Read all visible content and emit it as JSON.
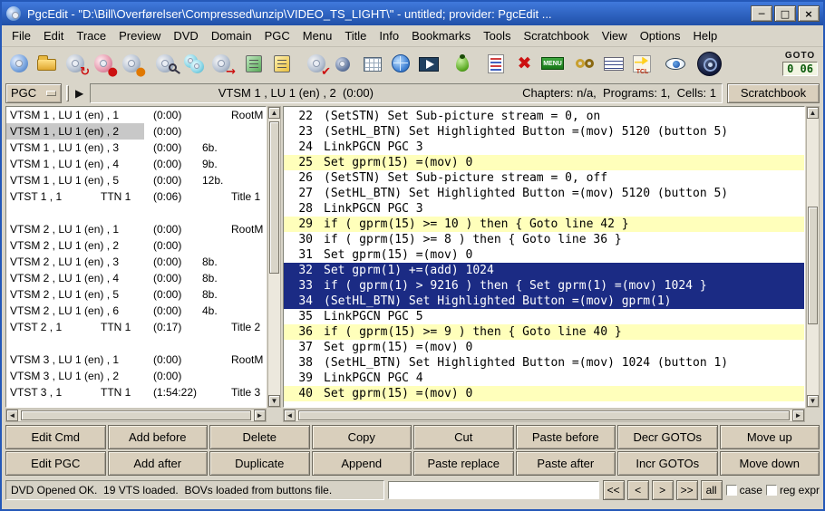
{
  "window": {
    "title": "PgcEdit -  \"D:\\Bill\\Overførelser\\Compressed\\unzip\\VIDEO_TS_LIGHT\\\" - untitled; provider: PgcEdit ...",
    "minimize": "─",
    "maximize": "□",
    "close": "×"
  },
  "menubar": {
    "items": [
      "File",
      "Edit",
      "Trace",
      "Preview",
      "DVD",
      "Domain",
      "PGC",
      "Menu",
      "Title",
      "Info",
      "Bookmarks",
      "Tools",
      "Scratchbook",
      "View",
      "Options",
      "Help"
    ]
  },
  "toolbar": {
    "icons": [
      {
        "name": "open-dvd-icon",
        "type": "disc-blue"
      },
      {
        "name": "open-folder-icon",
        "type": "folder"
      },
      {
        "name": "reopen-dvd-icon",
        "type": "disc-reload"
      },
      {
        "name": "save-dvd-icon",
        "type": "disc-save"
      },
      {
        "name": "burn-dvd-icon",
        "type": "disc-burn"
      },
      {
        "name": "preview-dvd-icon",
        "type": "disc-zoom",
        "ml": 6
      },
      {
        "name": "copy-dvd-icon",
        "type": "disc-copy"
      },
      {
        "name": "export-dvd-icon",
        "type": "disc-export"
      },
      {
        "name": "log-book-icon",
        "type": "book-green",
        "ml": 6
      },
      {
        "name": "notes-book-icon",
        "type": "book-yellow"
      },
      {
        "name": "verify-dvd-icon",
        "type": "disc-check",
        "ml": 6
      },
      {
        "name": "small-dvd-icon",
        "type": "disc-small"
      },
      {
        "name": "cell-table-icon",
        "type": "grid"
      },
      {
        "name": "globe-icon",
        "type": "globe"
      },
      {
        "name": "video-player-icon",
        "type": "film"
      },
      {
        "name": "debug-bug-icon",
        "type": "bug",
        "ml": 6
      },
      {
        "name": "command-list-icon",
        "type": "cmdlist",
        "ml": 6
      },
      {
        "name": "kill-menu-icon",
        "type": "kill"
      },
      {
        "name": "menu-editor-icon",
        "type": "menu-green",
        "text": "MENU"
      },
      {
        "name": "link-chain-icon",
        "type": "link",
        "ml": 6
      },
      {
        "name": "counter-icon",
        "type": "counter"
      },
      {
        "name": "tcl-console-icon",
        "type": "tcl",
        "text": "TCL"
      },
      {
        "name": "preview-eye-icon",
        "type": "eye",
        "ml": 6
      },
      {
        "name": "trace-wheel-icon",
        "type": "wheel",
        "ml": 6
      }
    ],
    "goto": {
      "label": "GOTO",
      "value": "0 06"
    }
  },
  "pgcbar": {
    "selector_label": "PGC",
    "play_glyph": "▶",
    "current_pgc": "VTSM 1 , LU 1 (en) , 2  (0:00)",
    "stats": "Chapters: n/a,  Programs: 1,  Cells: 1",
    "scratchbook_label": "Scratchbook"
  },
  "pgc_list": {
    "rows": [
      {
        "name": "VTSM 1 , LU 1 (en) , 1",
        "ttn": "",
        "time": "(0:00)",
        "buttons": "",
        "label": "RootM",
        "selected": false
      },
      {
        "name": "VTSM 1 , LU 1 (en) , 2",
        "ttn": "",
        "time": "(0:00)",
        "buttons": "",
        "label": "",
        "selected": true
      },
      {
        "name": "VTSM 1 , LU 1 (en) , 3",
        "ttn": "",
        "time": "(0:00)",
        "buttons": "6b.",
        "label": "",
        "selected": false
      },
      {
        "name": "VTSM 1 , LU 1 (en) , 4",
        "ttn": "",
        "time": "(0:00)",
        "buttons": "9b.",
        "label": "",
        "selected": false
      },
      {
        "name": "VTSM 1 , LU 1 (en) , 5",
        "ttn": "",
        "time": "(0:00)",
        "buttons": "12b.",
        "label": "",
        "selected": false
      },
      {
        "name": "VTST 1 , 1",
        "ttn": "TTN 1",
        "time": "(0:06)",
        "buttons": "",
        "label": "Title 1",
        "selected": false
      },
      {
        "name": "",
        "ttn": "",
        "time": "",
        "buttons": "",
        "label": "",
        "selected": false
      },
      {
        "name": "VTSM 2 , LU 1 (en) , 1",
        "ttn": "",
        "time": "(0:00)",
        "buttons": "",
        "label": "RootM",
        "selected": false
      },
      {
        "name": "VTSM 2 , LU 1 (en) , 2",
        "ttn": "",
        "time": "(0:00)",
        "buttons": "",
        "label": "",
        "selected": false
      },
      {
        "name": "VTSM 2 , LU 1 (en) , 3",
        "ttn": "",
        "time": "(0:00)",
        "buttons": "8b.",
        "label": "",
        "selected": false
      },
      {
        "name": "VTSM 2 , LU 1 (en) , 4",
        "ttn": "",
        "time": "(0:00)",
        "buttons": "8b.",
        "label": "",
        "selected": false
      },
      {
        "name": "VTSM 2 , LU 1 (en) , 5",
        "ttn": "",
        "time": "(0:00)",
        "buttons": "8b.",
        "label": "",
        "selected": false
      },
      {
        "name": "VTSM 2 , LU 1 (en) , 6",
        "ttn": "",
        "time": "(0:00)",
        "buttons": "4b.",
        "label": "",
        "selected": false
      },
      {
        "name": "VTST 2 , 1",
        "ttn": "TTN 1",
        "time": "(0:17)",
        "buttons": "",
        "label": "Title 2",
        "selected": false
      },
      {
        "name": "",
        "ttn": "",
        "time": "",
        "buttons": "",
        "label": "",
        "selected": false
      },
      {
        "name": "VTSM 3 , LU 1 (en) , 1",
        "ttn": "",
        "time": "(0:00)",
        "buttons": "",
        "label": "RootM",
        "selected": false
      },
      {
        "name": "VTSM 3 , LU 1 (en) , 2",
        "ttn": "",
        "time": "(0:00)",
        "buttons": "",
        "label": "",
        "selected": false
      },
      {
        "name": "VTST 3 , 1",
        "ttn": "TTN 1",
        "time": "(1:54:22)",
        "buttons": "",
        "label": "Title 3",
        "selected": false
      }
    ]
  },
  "commands": {
    "lines": [
      {
        "num": "22",
        "text": "(SetSTN) Set Sub-picture stream = 0, on",
        "hl": "none"
      },
      {
        "num": "23",
        "text": "(SetHL_BTN) Set Highlighted Button =(mov) 5120 (button 5)",
        "hl": "none"
      },
      {
        "num": "24",
        "text": "LinkPGCN PGC 3",
        "hl": "none"
      },
      {
        "num": "25",
        "text": "Set gprm(15) =(mov) 0",
        "hl": "yellow"
      },
      {
        "num": "26",
        "text": "(SetSTN) Set Sub-picture stream = 0, off",
        "hl": "none"
      },
      {
        "num": "27",
        "text": "(SetHL_BTN) Set Highlighted Button =(mov) 5120 (button 5)",
        "hl": "none"
      },
      {
        "num": "28",
        "text": "LinkPGCN PGC 3",
        "hl": "none"
      },
      {
        "num": "29",
        "text": "if ( gprm(15) >= 10 ) then { Goto line 42 }",
        "hl": "yellow"
      },
      {
        "num": "30",
        "text": "if ( gprm(15) >= 8 ) then { Goto line 36 }",
        "hl": "none"
      },
      {
        "num": "31",
        "text": "Set gprm(15) =(mov) 0",
        "hl": "none"
      },
      {
        "num": "32",
        "text": "Set gprm(1) +=(add) 1024",
        "hl": "selected"
      },
      {
        "num": "33",
        "text": "if ( gprm(1) > 9216 ) then { Set gprm(1) =(mov) 1024 }",
        "hl": "selected"
      },
      {
        "num": "34",
        "text": "(SetHL_BTN) Set Highlighted Button =(mov) gprm(1)",
        "hl": "selected"
      },
      {
        "num": "35",
        "text": "LinkPGCN PGC 5",
        "hl": "none"
      },
      {
        "num": "36",
        "text": "if ( gprm(15) >= 9 ) then { Goto line 40 }",
        "hl": "yellow"
      },
      {
        "num": "37",
        "text": "Set gprm(15) =(mov) 0",
        "hl": "none"
      },
      {
        "num": "38",
        "text": "(SetHL_BTN) Set Highlighted Button =(mov) 1024 (button 1)",
        "hl": "none"
      },
      {
        "num": "39",
        "text": "LinkPGCN PGC 4",
        "hl": "none"
      },
      {
        "num": "40",
        "text": "Set gprm(15) =(mov) 0",
        "hl": "yellow"
      }
    ]
  },
  "command_buttons": {
    "row1": [
      "Edit Cmd",
      "Add before",
      "Delete",
      "Copy",
      "Cut",
      "Paste before",
      "Decr GOTOs",
      "Move up"
    ],
    "row2": [
      "Edit PGC",
      "Add after",
      "Duplicate",
      "Append",
      "Paste replace",
      "Paste after",
      "Incr GOTOs",
      "Move down"
    ]
  },
  "statusbar": {
    "message": "DVD Opened OK.  19 VTS loaded.  BOVs loaded from buttons file.",
    "search_value": "",
    "nav_buttons": [
      "<<",
      "<",
      ">",
      ">>",
      "all"
    ],
    "case_label": "case",
    "regexp_label": "reg expr"
  }
}
